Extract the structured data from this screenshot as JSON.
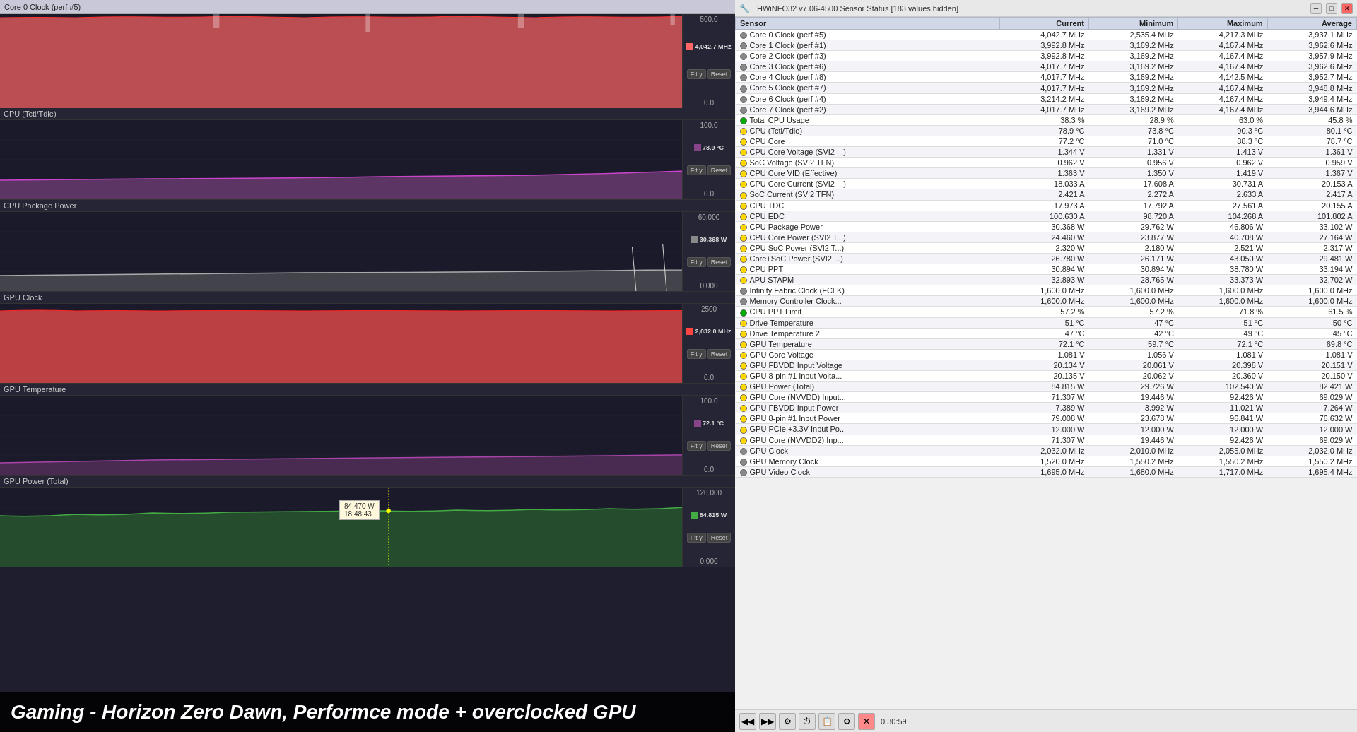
{
  "leftPanel": {
    "windowTitle": "Core 0 Clock (perf #5)",
    "sections": [
      {
        "id": "core0clock",
        "title": "Core 0 Clock (perf #5)",
        "maxVal": "500.0",
        "currentVal": "4,042.7 MHz",
        "minVal": "0.0",
        "color": "#ff6666",
        "graphType": "line-filled-red"
      },
      {
        "id": "cpuTctl",
        "title": "CPU (Tctl/Tdie)",
        "maxVal": "100.0",
        "currentVal": "78.9 °C",
        "minVal": "0.0",
        "color": "#aa44aa",
        "graphType": "line-purple"
      },
      {
        "id": "cpuPackage",
        "title": "CPU Package Power",
        "maxVal": "60.000",
        "currentVal": "30.368 W",
        "minVal": "0.000",
        "color": "#888888",
        "graphType": "line-gray"
      },
      {
        "id": "gpuClock",
        "title": "GPU Clock",
        "maxVal": "2500",
        "currentVal": "2,032.0 MHz",
        "minVal": "0.0",
        "color": "#ff4444",
        "graphType": "line-filled-red"
      },
      {
        "id": "gpuTemp",
        "title": "GPU Temperature",
        "maxVal": "100.0",
        "currentVal": "72.1 °C",
        "minVal": "0.0",
        "color": "#884488",
        "graphType": "line-purple-dark"
      },
      {
        "id": "gpuPower",
        "title": "GPU Power (Total)",
        "maxVal": "120.000",
        "currentVal": "84.815 W",
        "minVal": "0.000",
        "color": "#44aa44",
        "graphType": "line-green",
        "tooltip": {
          "value": "84.470 W",
          "time": "18:48:43"
        }
      }
    ],
    "bottomText": "Gaming - Horizon Zero Dawn, Performce mode + overclocked GPU"
  },
  "rightPanel": {
    "title": "HWiNFO32 v7.06-4500 Sensor Status [183 values hidden]",
    "columns": [
      "Sensor",
      "Current",
      "Minimum",
      "Maximum",
      "Average"
    ],
    "rows": [
      {
        "icon": "gray",
        "name": "Core 0 Clock (perf #5)",
        "current": "4,042.7 MHz",
        "minimum": "2,535.4 MHz",
        "maximum": "4,217.3 MHz",
        "average": "3,937.1 MHz"
      },
      {
        "icon": "gray",
        "name": "Core 1 Clock (perf #1)",
        "current": "3,992.8 MHz",
        "minimum": "3,169.2 MHz",
        "maximum": "4,167.4 MHz",
        "average": "3,962.6 MHz"
      },
      {
        "icon": "gray",
        "name": "Core 2 Clock (perf #3)",
        "current": "3,992.8 MHz",
        "minimum": "3,169.2 MHz",
        "maximum": "4,167.4 MHz",
        "average": "3,957.9 MHz"
      },
      {
        "icon": "gray",
        "name": "Core 3 Clock (perf #6)",
        "current": "4,017.7 MHz",
        "minimum": "3,169.2 MHz",
        "maximum": "4,167.4 MHz",
        "average": "3,962.6 MHz"
      },
      {
        "icon": "gray",
        "name": "Core 4 Clock (perf #8)",
        "current": "4,017.7 MHz",
        "minimum": "3,169.2 MHz",
        "maximum": "4,142.5 MHz",
        "average": "3,952.7 MHz"
      },
      {
        "icon": "gray",
        "name": "Core 5 Clock (perf #7)",
        "current": "4,017.7 MHz",
        "minimum": "3,169.2 MHz",
        "maximum": "4,167.4 MHz",
        "average": "3,948.8 MHz"
      },
      {
        "icon": "gray",
        "name": "Core 6 Clock (perf #4)",
        "current": "3,214.2 MHz",
        "minimum": "3,169.2 MHz",
        "maximum": "4,167.4 MHz",
        "average": "3,949.4 MHz"
      },
      {
        "icon": "gray",
        "name": "Core 7 Clock (perf #2)",
        "current": "4,017.7 MHz",
        "minimum": "3,169.2 MHz",
        "maximum": "4,167.4 MHz",
        "average": "3,944.6 MHz"
      },
      {
        "icon": "green",
        "name": "Total CPU Usage",
        "current": "38.3 %",
        "minimum": "28.9 %",
        "maximum": "63.0 %",
        "average": "45.8 %"
      },
      {
        "icon": "yellow",
        "name": "CPU (Tctl/Tdie)",
        "current": "78.9 °C",
        "minimum": "73.8 °C",
        "maximum": "90.3 °C",
        "average": "80.1 °C"
      },
      {
        "icon": "yellow",
        "name": "CPU Core",
        "current": "77.2 °C",
        "minimum": "71.0 °C",
        "maximum": "88.3 °C",
        "average": "78.7 °C"
      },
      {
        "icon": "yellow",
        "name": "CPU Core Voltage (SVI2 ...)",
        "current": "1.344 V",
        "minimum": "1.331 V",
        "maximum": "1.413 V",
        "average": "1.361 V"
      },
      {
        "icon": "yellow",
        "name": "SoC Voltage (SVI2 TFN)",
        "current": "0.962 V",
        "minimum": "0.956 V",
        "maximum": "0.962 V",
        "average": "0.959 V"
      },
      {
        "icon": "yellow",
        "name": "CPU Core VID (Effective)",
        "current": "1.363 V",
        "minimum": "1.350 V",
        "maximum": "1.419 V",
        "average": "1.367 V"
      },
      {
        "icon": "yellow",
        "name": "CPU Core Current (SVI2 ...)",
        "current": "18.033 A",
        "minimum": "17.608 A",
        "maximum": "30.731 A",
        "average": "20.153 A"
      },
      {
        "icon": "yellow",
        "name": "SoC Current (SVI2 TFN)",
        "current": "2.421 A",
        "minimum": "2.272 A",
        "maximum": "2.633 A",
        "average": "2.417 A"
      },
      {
        "icon": "yellow",
        "name": "CPU TDC",
        "current": "17.973 A",
        "minimum": "17.792 A",
        "maximum": "27.561 A",
        "average": "20.155 A"
      },
      {
        "icon": "yellow",
        "name": "CPU EDC",
        "current": "100.630 A",
        "minimum": "98.720 A",
        "maximum": "104.268 A",
        "average": "101.802 A"
      },
      {
        "icon": "yellow",
        "name": "CPU Package Power",
        "current": "30.368 W",
        "minimum": "29.762 W",
        "maximum": "46.806 W",
        "average": "33.102 W"
      },
      {
        "icon": "yellow",
        "name": "CPU Core Power (SVI2 T...)",
        "current": "24.460 W",
        "minimum": "23.877 W",
        "maximum": "40.708 W",
        "average": "27.164 W"
      },
      {
        "icon": "yellow",
        "name": "CPU SoC Power (SVI2 T...)",
        "current": "2.320 W",
        "minimum": "2.180 W",
        "maximum": "2.521 W",
        "average": "2.317 W"
      },
      {
        "icon": "yellow",
        "name": "Core+SoC Power (SVI2 ...)",
        "current": "26.780 W",
        "minimum": "26.171 W",
        "maximum": "43.050 W",
        "average": "29.481 W"
      },
      {
        "icon": "yellow",
        "name": "CPU PPT",
        "current": "30.894 W",
        "minimum": "30.894 W",
        "maximum": "38.780 W",
        "average": "33.194 W"
      },
      {
        "icon": "yellow",
        "name": "APU STAPM",
        "current": "32.893 W",
        "minimum": "28.765 W",
        "maximum": "33.373 W",
        "average": "32.702 W"
      },
      {
        "icon": "gray",
        "name": "Infinity Fabric Clock (FCLK)",
        "current": "1,600.0 MHz",
        "minimum": "1,600.0 MHz",
        "maximum": "1,600.0 MHz",
        "average": "1,600.0 MHz"
      },
      {
        "icon": "gray",
        "name": "Memory Controller Clock...",
        "current": "1,600.0 MHz",
        "minimum": "1,600.0 MHz",
        "maximum": "1,600.0 MHz",
        "average": "1,600.0 MHz"
      },
      {
        "icon": "green",
        "name": "CPU PPT Limit",
        "current": "57.2 %",
        "minimum": "57.2 %",
        "maximum": "71.8 %",
        "average": "61.5 %"
      },
      {
        "icon": "yellow",
        "name": "Drive Temperature",
        "current": "51 °C",
        "minimum": "47 °C",
        "maximum": "51 °C",
        "average": "50 °C"
      },
      {
        "icon": "yellow",
        "name": "Drive Temperature 2",
        "current": "47 °C",
        "minimum": "42 °C",
        "maximum": "49 °C",
        "average": "45 °C"
      },
      {
        "icon": "yellow",
        "name": "GPU Temperature",
        "current": "72.1 °C",
        "minimum": "59.7 °C",
        "maximum": "72.1 °C",
        "average": "69.8 °C"
      },
      {
        "icon": "yellow",
        "name": "GPU Core Voltage",
        "current": "1.081 V",
        "minimum": "1.056 V",
        "maximum": "1.081 V",
        "average": "1.081 V"
      },
      {
        "icon": "yellow",
        "name": "GPU FBVDD Input Voltage",
        "current": "20.134 V",
        "minimum": "20.061 V",
        "maximum": "20.398 V",
        "average": "20.151 V"
      },
      {
        "icon": "yellow",
        "name": "GPU 8-pin #1 Input Volta...",
        "current": "20.135 V",
        "minimum": "20.062 V",
        "maximum": "20.360 V",
        "average": "20.150 V"
      },
      {
        "icon": "yellow",
        "name": "GPU Power (Total)",
        "current": "84.815 W",
        "minimum": "29.726 W",
        "maximum": "102.540 W",
        "average": "82.421 W"
      },
      {
        "icon": "yellow",
        "name": "GPU Core (NVVDD) Input...",
        "current": "71.307 W",
        "minimum": "19.446 W",
        "maximum": "92.426 W",
        "average": "69.029 W"
      },
      {
        "icon": "yellow",
        "name": "GPU FBVDD Input Power",
        "current": "7.389 W",
        "minimum": "3.992 W",
        "maximum": "11.021 W",
        "average": "7.264 W"
      },
      {
        "icon": "yellow",
        "name": "GPU 8-pin #1 Input Power",
        "current": "79.008 W",
        "minimum": "23.678 W",
        "maximum": "96.841 W",
        "average": "76.632 W"
      },
      {
        "icon": "yellow",
        "name": "GPU PCIe +3.3V Input Po...",
        "current": "12.000 W",
        "minimum": "12.000 W",
        "maximum": "12.000 W",
        "average": "12.000 W"
      },
      {
        "icon": "yellow",
        "name": "GPU Core (NVVDD2) Inp...",
        "current": "71.307 W",
        "minimum": "19.446 W",
        "maximum": "92.426 W",
        "average": "69.029 W"
      },
      {
        "icon": "gray",
        "name": "GPU Clock",
        "current": "2,032.0 MHz",
        "minimum": "2,010.0 MHz",
        "maximum": "2,055.0 MHz",
        "average": "2,032.0 MHz"
      },
      {
        "icon": "gray",
        "name": "GPU Memory Clock",
        "current": "1,520.0 MHz",
        "minimum": "1,550.2 MHz",
        "maximum": "1,550.2 MHz",
        "average": "1,550.2 MHz"
      },
      {
        "icon": "gray",
        "name": "GPU Video Clock",
        "current": "1,695.0 MHz",
        "minimum": "1,680.0 MHz",
        "maximum": "1,717.0 MHz",
        "average": "1,695.4 MHz"
      }
    ],
    "toolbar": {
      "time": "0:30:59"
    }
  }
}
